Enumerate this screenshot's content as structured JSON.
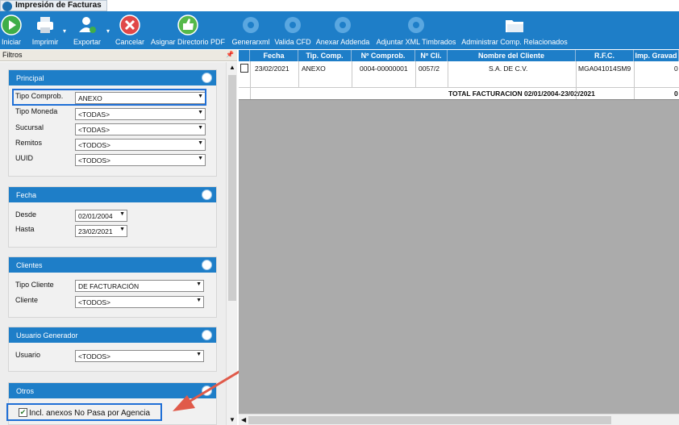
{
  "window": {
    "tab_title": "Impresión de Facturas"
  },
  "toolbar": {
    "buttons": [
      {
        "label": "Iniciar",
        "icon": "play-icon"
      },
      {
        "label": "Imprimir",
        "icon": "printer-icon"
      },
      {
        "label": "Exportar",
        "icon": "export-user-icon"
      },
      {
        "label": "Cancelar",
        "icon": "cancel-icon"
      },
      {
        "label": "Asignar Directorio PDF",
        "icon": "thumbs-up-icon"
      },
      {
        "label": "Generarxml",
        "icon": "gear-icon"
      },
      {
        "label": "Valida CFD",
        "icon": "gear-icon"
      },
      {
        "label": "Anexar Addenda",
        "icon": "gear-icon"
      },
      {
        "label": "Adjuntar XML Timbrados",
        "icon": "gear-icon"
      },
      {
        "label": "Administrar Comp. Relacionados",
        "icon": "folder-icon"
      }
    ]
  },
  "filters": {
    "title": "Filtros",
    "principal": {
      "title": "Principal",
      "rows": [
        {
          "label": "Tipo Comprob.",
          "value": "ANEXO"
        },
        {
          "label": "Tipo Moneda",
          "value": "<TODAS>"
        },
        {
          "label": "Sucursal",
          "value": "<TODAS>"
        },
        {
          "label": "Remitos",
          "value": "<TODOS>"
        },
        {
          "label": "UUID",
          "value": "<TODOS>"
        }
      ]
    },
    "fecha": {
      "title": "Fecha",
      "rows": [
        {
          "label": "Desde",
          "value": "02/01/2004"
        },
        {
          "label": "Hasta",
          "value": "23/02/2021"
        }
      ]
    },
    "clientes": {
      "title": "Clientes",
      "rows": [
        {
          "label": "Tipo Cliente",
          "value": "DE FACTURACIÓN"
        },
        {
          "label": "Cliente",
          "value": "<TODOS>"
        }
      ]
    },
    "usuario": {
      "title": "Usuario Generador",
      "rows": [
        {
          "label": "Usuario",
          "value": "<TODOS>"
        }
      ]
    },
    "otros": {
      "title": "Otros",
      "checkbox_label": "Incl. anexos No Pasa por Agencia",
      "checked": true
    }
  },
  "grid": {
    "columns": [
      "Fecha",
      "Tip. Comp.",
      "Nº Comprob.",
      "Nº Cli.",
      "Nombre del Cliente",
      "R.F.C.",
      "Imp. Gravad"
    ],
    "rows": [
      {
        "fecha": "23/02/2021",
        "tipo": "ANEXO",
        "comprob": "0004-00000001",
        "cli": "0057/2",
        "nombre": "S.A. DE C.V.",
        "rfc": "MGA041014SM9",
        "imp": "0"
      }
    ],
    "total_label": "TOTAL FACTURACION 02/01/2004-23/02/2021",
    "total_value": "0"
  },
  "colors": {
    "accent": "#1e7ec8",
    "highlight": "#1f6fd6",
    "arrow": "#e05a4a"
  }
}
